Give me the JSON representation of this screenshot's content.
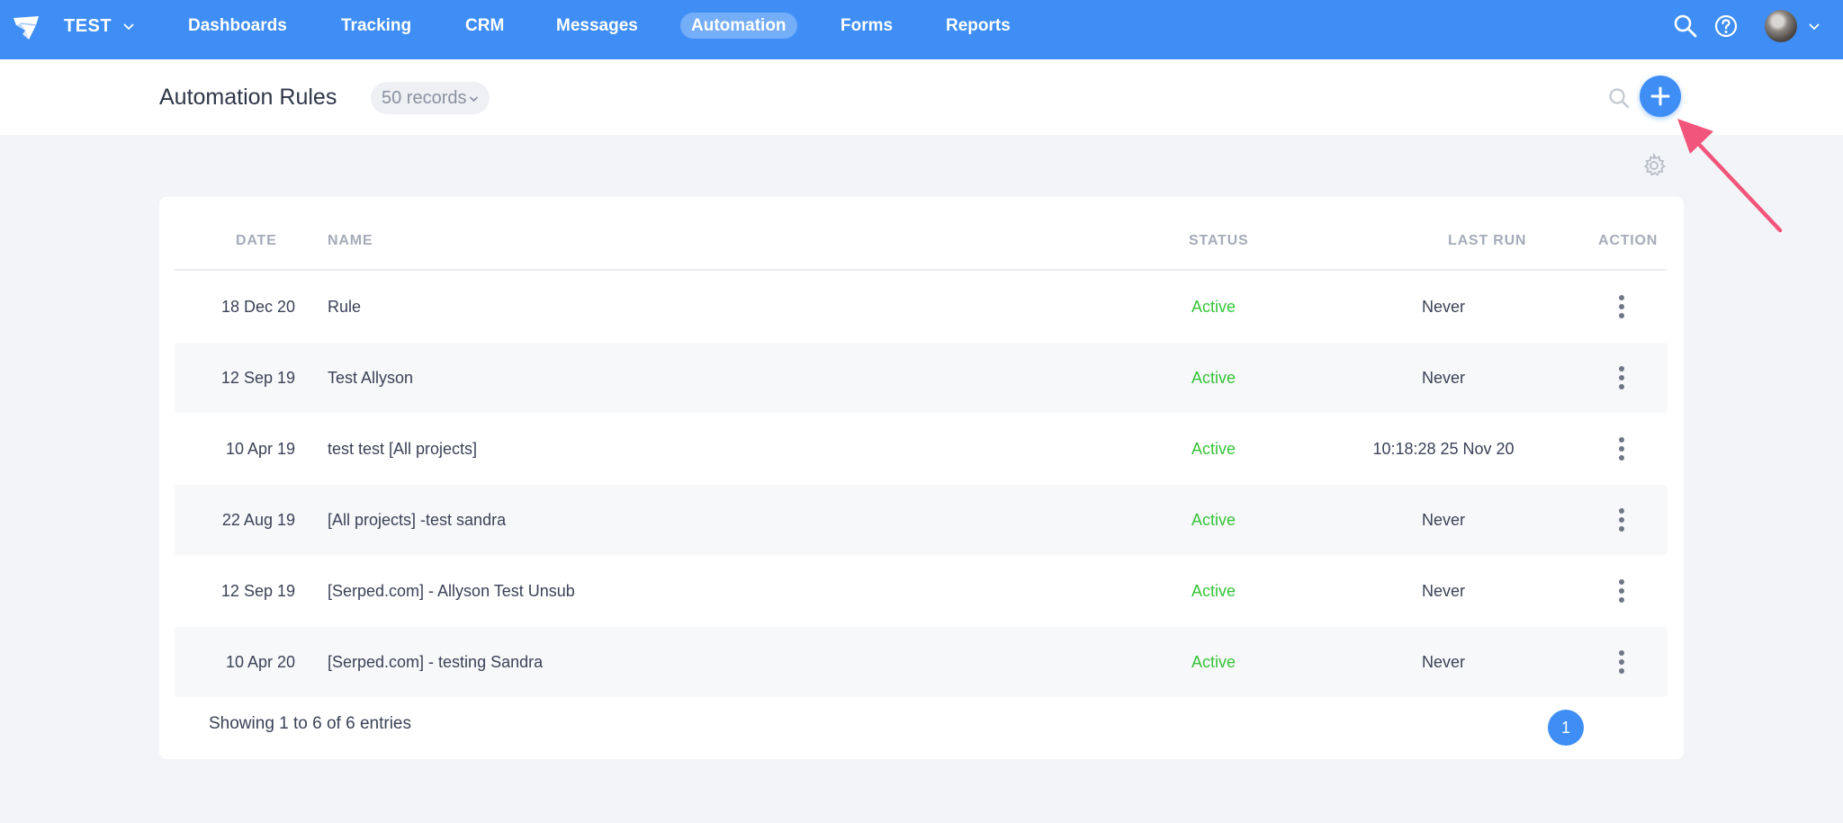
{
  "topbar": {
    "workspace": "TEST",
    "nav": [
      {
        "label": "Dashboards"
      },
      {
        "label": "Tracking"
      },
      {
        "label": "CRM"
      },
      {
        "label": "Messages"
      },
      {
        "label": "Automation",
        "active": true
      },
      {
        "label": "Forms"
      },
      {
        "label": "Reports"
      }
    ],
    "icons": [
      "search-icon",
      "help-icon",
      "avatar",
      "chevron-down-icon"
    ]
  },
  "header": {
    "title": "Automation Rules",
    "records": "50 records",
    "icons": [
      "search-icon",
      "plus-icon",
      "gear-icon"
    ]
  },
  "table": {
    "columns": {
      "date": "DATE",
      "name": "NAME",
      "status": "STATUS",
      "last_run": "LAST RUN",
      "action": "ACTION"
    },
    "rows": [
      {
        "date": "18 Dec 20",
        "name": "Rule",
        "status": "Active",
        "last_run": "Never"
      },
      {
        "date": "12 Sep 19",
        "name": "Test Allyson",
        "status": "Active",
        "last_run": "Never"
      },
      {
        "date": "10 Apr 19",
        "name": "test test [All projects]",
        "status": "Active",
        "last_run": "10:18:28 25 Nov 20"
      },
      {
        "date": "22 Aug 19",
        "name": "[All projects] -test sandra",
        "status": "Active",
        "last_run": "Never"
      },
      {
        "date": "12 Sep 19",
        "name": "[Serped.com] - Allyson Test Unsub",
        "status": "Active",
        "last_run": "Never"
      },
      {
        "date": "10 Apr 20",
        "name": "[Serped.com] - testing Sandra",
        "status": "Active",
        "last_run": "Never"
      }
    ],
    "footer": "Showing 1 to 6 of 6 entries",
    "page": "1"
  },
  "colors": {
    "brand": "#3f8ef5",
    "status_active": "#35c437",
    "annotation_arrow": "#f2557b"
  }
}
